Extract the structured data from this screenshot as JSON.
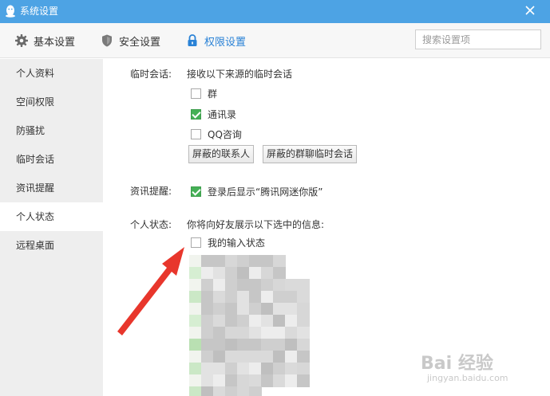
{
  "window": {
    "title": "系统设置",
    "close_icon": "close-icon"
  },
  "toolbar": {
    "tabs": [
      {
        "label": "基本设置",
        "icon": "gear-icon"
      },
      {
        "label": "安全设置",
        "icon": "shield-icon"
      },
      {
        "label": "权限设置",
        "icon": "lock-icon",
        "active": true
      }
    ],
    "search_placeholder": "搜索设置项"
  },
  "sidebar": {
    "items": [
      {
        "label": "个人资料"
      },
      {
        "label": "空间权限"
      },
      {
        "label": "防骚扰"
      },
      {
        "label": "临时会话"
      },
      {
        "label": "资讯提醒"
      },
      {
        "label": "个人状态",
        "active": true
      },
      {
        "label": "远程桌面"
      }
    ]
  },
  "main": {
    "temp_session": {
      "label": "临时会话:",
      "desc": "接收以下来源的临时会话",
      "options": [
        {
          "label": "群",
          "checked": false
        },
        {
          "label": "通讯录",
          "checked": true
        },
        {
          "label": "QQ咨询",
          "checked": false
        }
      ],
      "btn_blocked_contacts": "屏蔽的联系人",
      "btn_blocked_group_chat": "屏蔽的群聊临时会话"
    },
    "news_reminder": {
      "label": "资讯提醒:",
      "option": {
        "label": "登录后显示“腾讯网迷你版”",
        "checked": true
      }
    },
    "personal_status": {
      "label": "个人状态:",
      "desc": "你将向好友展示以下选中的信息:",
      "option": {
        "label": "我的输入状态",
        "checked": false
      }
    }
  },
  "annotation": {
    "arrow_color": "#e8362c"
  },
  "watermark": {
    "brand": "Bai 经验",
    "url": "jingyan.baidu.com"
  },
  "colors": {
    "titlebar": "#4da3e4",
    "accent": "#2a82d6",
    "checkbox_checked": "#45b056",
    "sidebar_bg": "#eeeeee"
  }
}
